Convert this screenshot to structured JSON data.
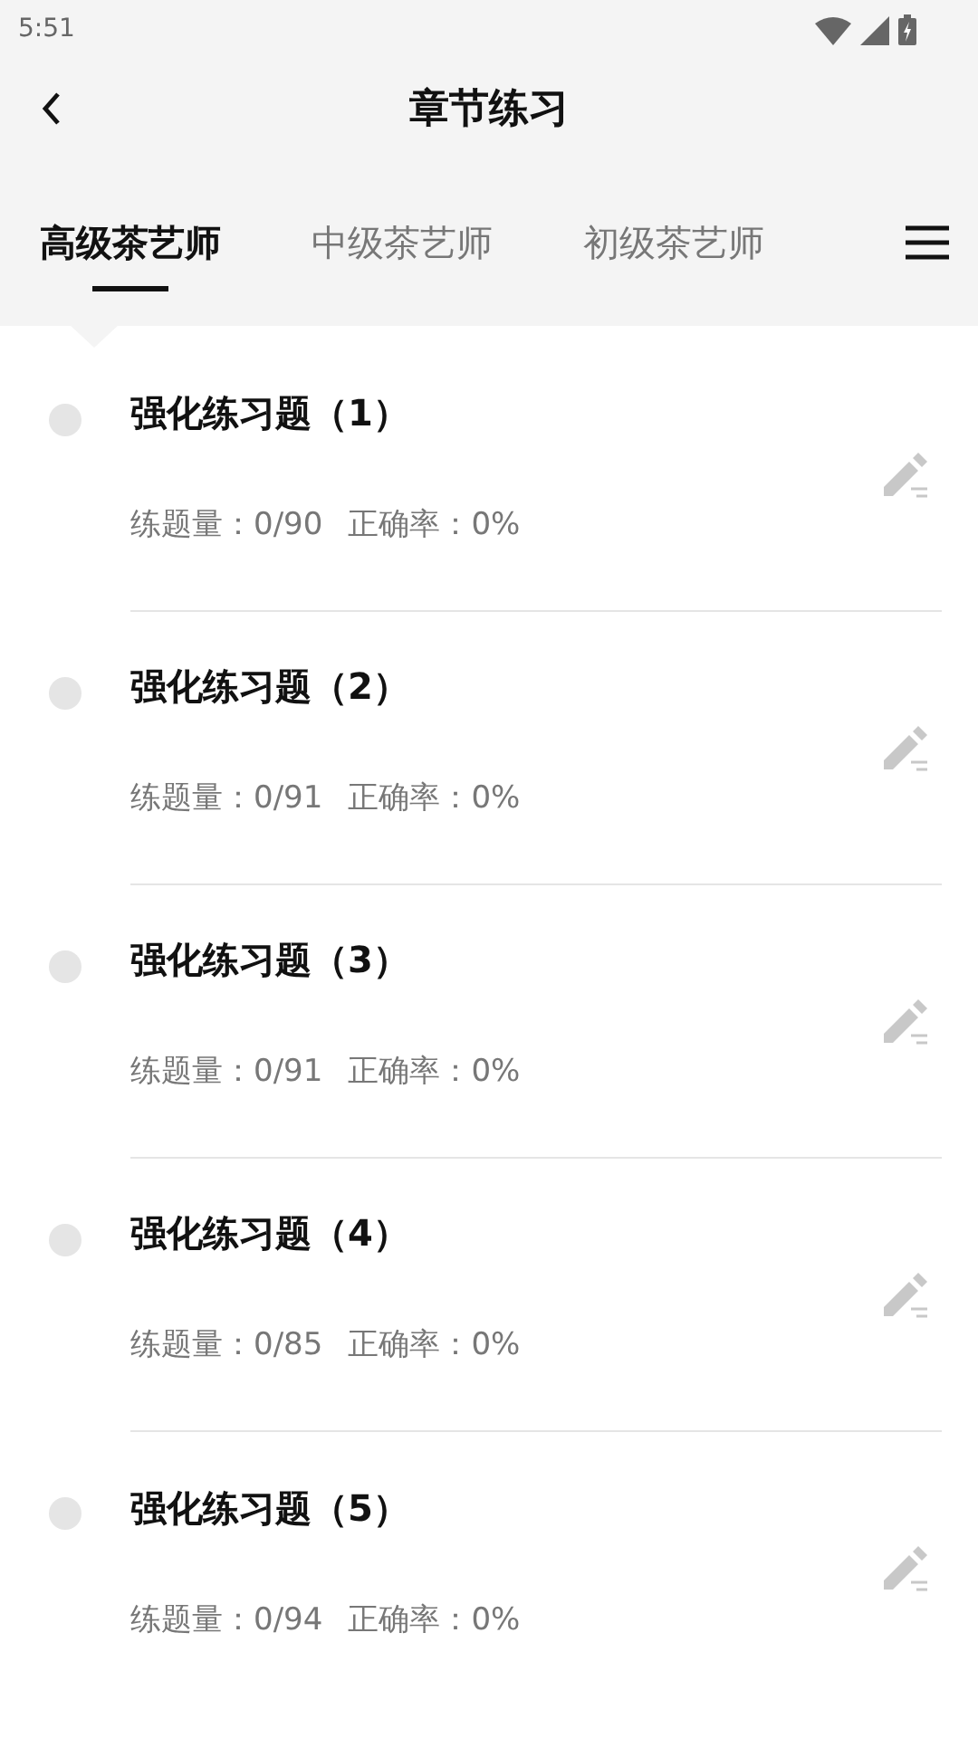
{
  "status_bar": {
    "time": "5:51"
  },
  "header": {
    "title": "章节练习"
  },
  "tabs": [
    {
      "label": "高级茶艺师",
      "selected": true
    },
    {
      "label": "中级茶艺师",
      "selected": false
    },
    {
      "label": "初级茶艺师",
      "selected": false
    }
  ],
  "exercises": [
    {
      "title": "强化练习题（1）",
      "count": "练题量：0/90",
      "accuracy": "正确率：0%"
    },
    {
      "title": "强化练习题（2）",
      "count": "练题量：0/91",
      "accuracy": "正确率：0%"
    },
    {
      "title": "强化练习题（3）",
      "count": "练题量：0/91",
      "accuracy": "正确率：0%"
    },
    {
      "title": "强化练习题（4）",
      "count": "练题量：0/85",
      "accuracy": "正确率：0%"
    },
    {
      "title": "强化练习题（5）",
      "count": "练题量：0/94",
      "accuracy": "正确率：0%"
    }
  ]
}
